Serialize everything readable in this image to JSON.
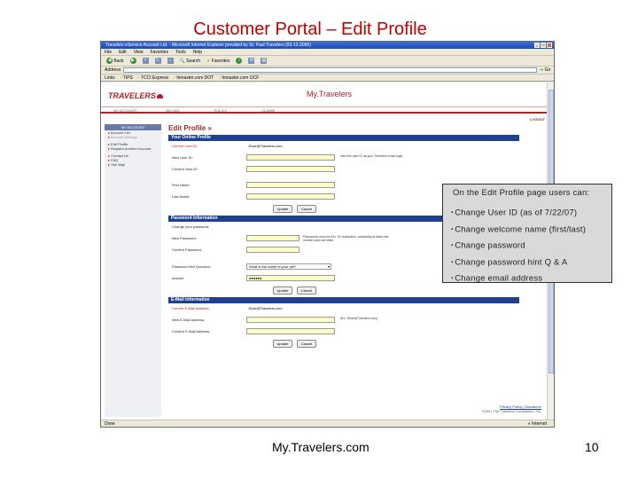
{
  "slide": {
    "title": "Customer Portal – Edit Profile",
    "footer": "My.Travelers.com",
    "page_number": "10"
  },
  "browser": {
    "window_title": "Travelers eService Account Ltd. - Microsoft Internet Explorer provided by St. Paul Travelers (03-13-2006)",
    "menu": [
      "File",
      "Edit",
      "View",
      "Favorites",
      "Tools",
      "Help"
    ],
    "toolbar": {
      "back": "Back",
      "search": "Search",
      "favorites": "Favorites"
    },
    "address_label": "Address",
    "go_label": "Go",
    "links": [
      "Links",
      "TIPS",
      "TCCI Express",
      "Inmaster.com DOT",
      "Inmaster.com OCF"
    ],
    "status_left": "Done",
    "status_zone": "Internet"
  },
  "site": {
    "logo": "TRAVELERS",
    "brand": "My.Travelers",
    "nav": [
      "MY ACCOUNT",
      "BILLING",
      "POLICY",
      "CLAIMS"
    ],
    "logout": "LOGOUT"
  },
  "sidebar": {
    "header": "MY ACCOUNT",
    "items_top": [
      "Account List",
      "Account Settings"
    ],
    "items_mid": [
      "Edit Profile",
      "Register Another Account"
    ],
    "items_bot": [
      "Contact Us",
      "FAQ",
      "Site Map"
    ]
  },
  "page": {
    "title": "Edit Profile",
    "online_profile": {
      "header": "Your Online Profile",
      "current_id_label": "Current User ID:",
      "current_id_value": "JDoe@Travelers.com",
      "new_id_label": "New User ID:",
      "confirm_id_label": "Confirm New ID:",
      "id_hint": "Use this user ID as your Travelers email login",
      "first_name_label": "First Name:",
      "last_name_label": "Last Name:",
      "update": "Update",
      "cancel": "Cancel"
    },
    "password": {
      "header": "Password Information",
      "change_label": "Change your password:",
      "new_label": "New Password:",
      "confirm_label": "Confirm Password:",
      "hint": "Passwords must be 8 to 15 characters, containing at least one number and one letter",
      "question_label": "Password Hint Question:",
      "question_value": "What is the name of your pet?",
      "answer_label": "Answer:",
      "answer_value": "●●●●●●",
      "update": "Update",
      "cancel": "Cancel"
    },
    "email": {
      "header": "E-Mail Information",
      "current_label": "Current E-Mail Address:",
      "current_value": "JDoe@Travelers.com",
      "new_label": "New E-Mail Address:",
      "confirm_label": "Confirm E-Mail Address:",
      "hint": "(Ex: JDoe@Travelers.com)",
      "update": "Update",
      "cancel": "Cancel"
    },
    "footer": {
      "link": "Privacy Policy | Disclaimer",
      "copyright": "©2007 The Travelers Companies, Inc."
    }
  },
  "callout": {
    "intro": "On the Edit Profile page users can:",
    "bullets": [
      "Change User ID (as of 7/22/07)",
      "Change welcome name (first/last)",
      "Change password",
      "Change password hint Q & A",
      "Change email address"
    ]
  }
}
